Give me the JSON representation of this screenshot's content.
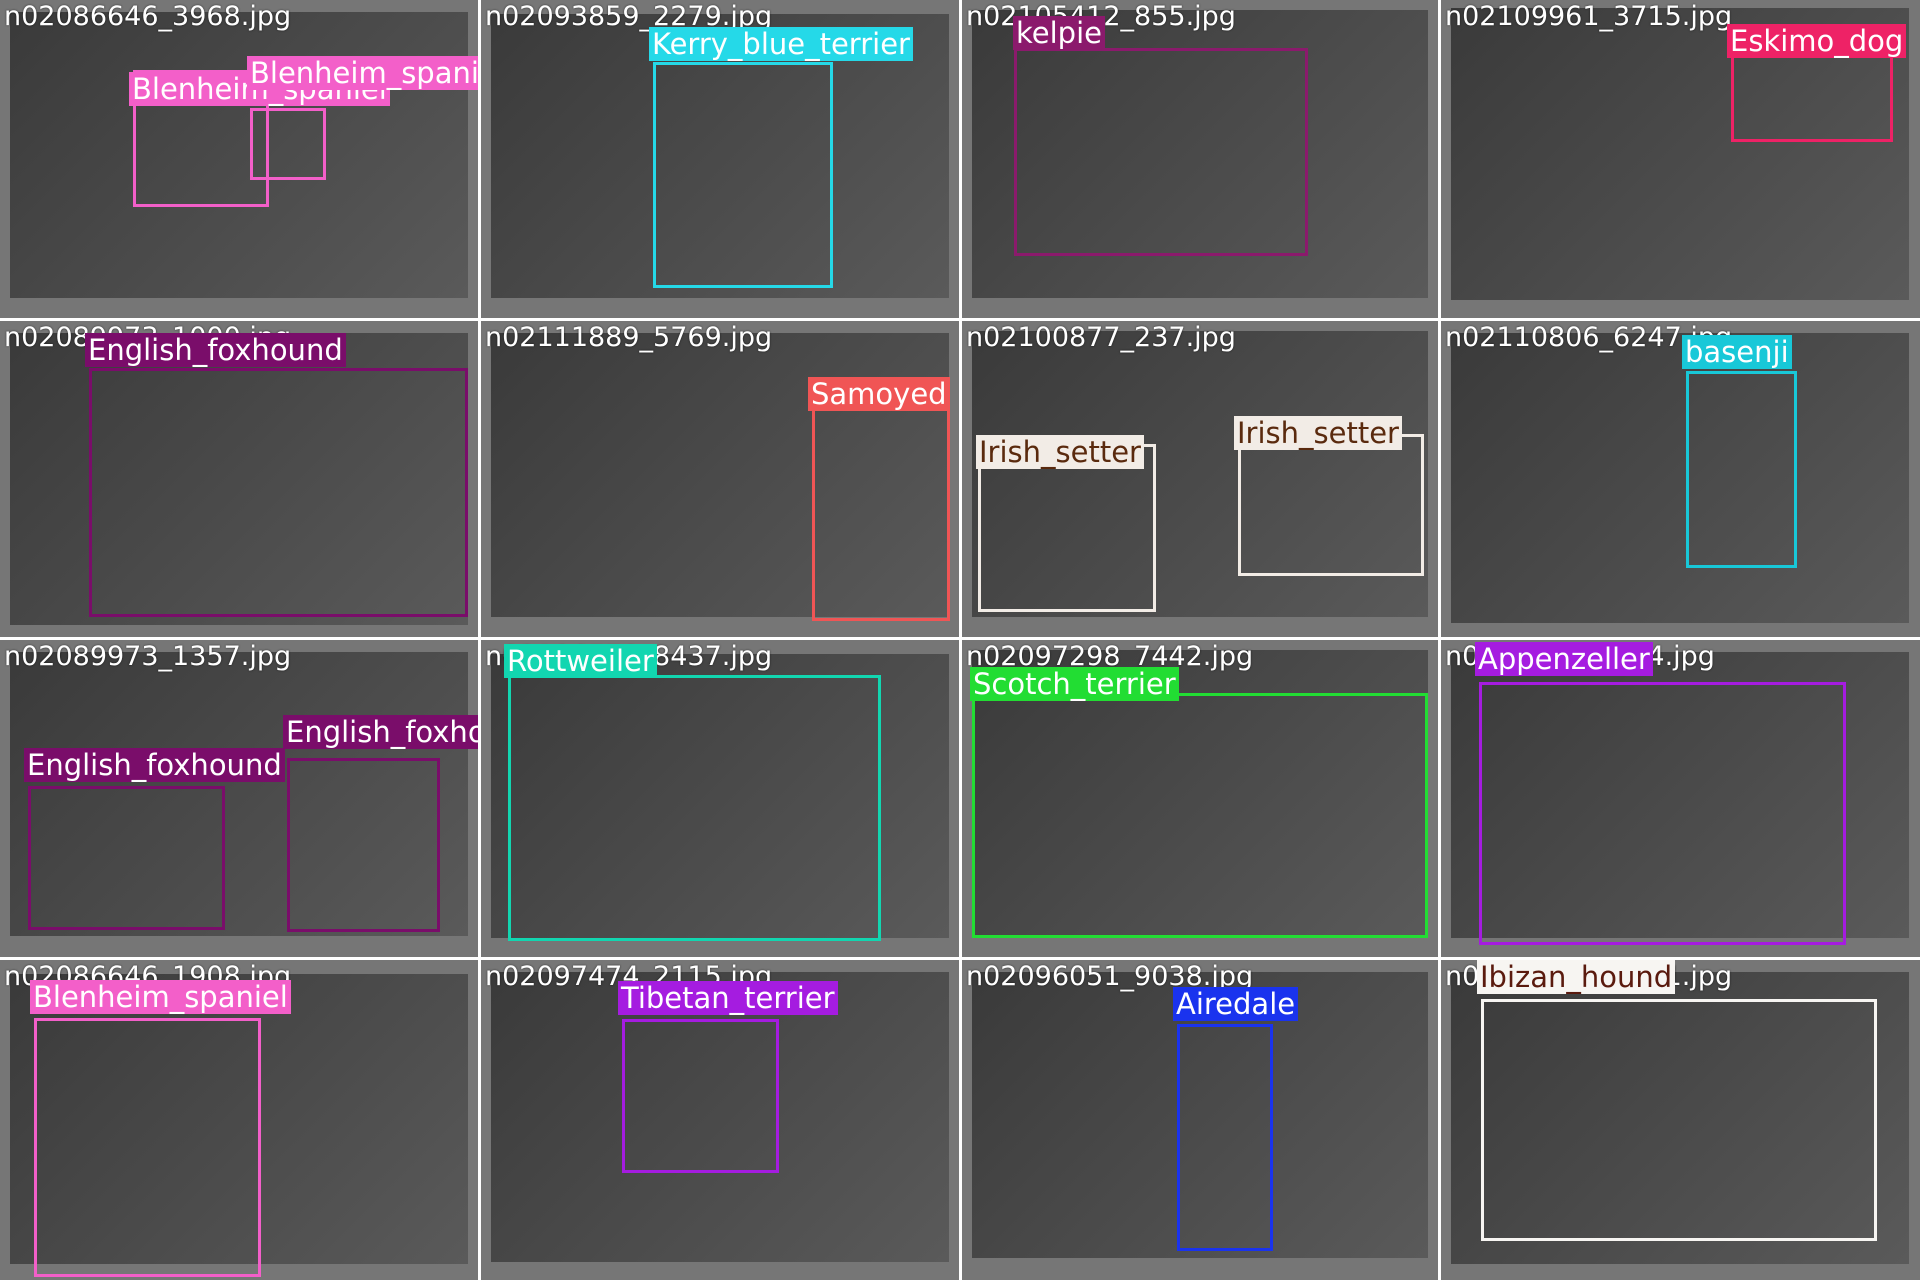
{
  "tiles": [
    {
      "filename": "n02086646_3968.jpg",
      "detections": [
        {
          "label": "Blenheim_spaniel",
          "color": "#f35fc9"
        },
        {
          "label": "Blenheim_spaniel",
          "color": "#f35fc9"
        }
      ]
    },
    {
      "filename": "n02093859_2279.jpg",
      "detections": [
        {
          "label": "Kerry_blue_terrier",
          "color": "#25d9e8"
        }
      ]
    },
    {
      "filename": "n02105412_855.jpg",
      "detections": [
        {
          "label": "kelpie",
          "color": "#8b1a6c"
        }
      ]
    },
    {
      "filename": "n02109961_3715.jpg",
      "detections": [
        {
          "label": "Eskimo_dog",
          "color": "#ee2266"
        }
      ]
    },
    {
      "filename": "n02089973_1000.jpg",
      "detections": [
        {
          "label": "English_foxhound",
          "color": "#7a0d6a"
        }
      ]
    },
    {
      "filename": "n02111889_5769.jpg",
      "detections": [
        {
          "label": "Samoyed",
          "color": "#f05555"
        }
      ]
    },
    {
      "filename": "n02100877_237.jpg",
      "detections": [
        {
          "label": "Irish_setter",
          "color": "#f2ece6",
          "text_color": "#5a2a0e"
        },
        {
          "label": "Irish_setter",
          "color": "#f2ece6",
          "text_color": "#5a2a0e"
        }
      ]
    },
    {
      "filename": "n02110806_6247.jpg",
      "detections": [
        {
          "label": "basenji",
          "color": "#18c8d8"
        }
      ]
    },
    {
      "filename": "n02089973_1357.jpg",
      "detections": [
        {
          "label": "English_foxhound",
          "color": "#7a0d6a"
        },
        {
          "label": "English_foxhound",
          "color": "#7a0d6a"
        }
      ]
    },
    {
      "filename": "n02106550_8437.jpg",
      "detections": [
        {
          "label": "Rottweiler",
          "color": "#12d6b0"
        }
      ]
    },
    {
      "filename": "n02097298_7442.jpg",
      "detections": [
        {
          "label": "Scotch_terrier",
          "color": "#22dd33"
        }
      ]
    },
    {
      "filename": "n02107908_704.jpg",
      "detections": [
        {
          "label": "Appenzeller",
          "color": "#a51ce0"
        }
      ]
    },
    {
      "filename": "n02086646_1908.jpg",
      "detections": [
        {
          "label": "Blenheim_spaniel",
          "color": "#f35fc9"
        }
      ]
    },
    {
      "filename": "n02097474_2115.jpg",
      "detections": [
        {
          "label": "Tibetan_terrier",
          "color": "#a51ce0"
        }
      ]
    },
    {
      "filename": "n02096051_9038.jpg",
      "detections": [
        {
          "label": "Airedale",
          "color": "#1a33ee"
        }
      ]
    },
    {
      "filename": "n02091244_4421.jpg",
      "detections": [
        {
          "label": "Ibizan_hound",
          "color": "#f7f5f2",
          "text_color": "#5a1a0e"
        }
      ]
    }
  ]
}
